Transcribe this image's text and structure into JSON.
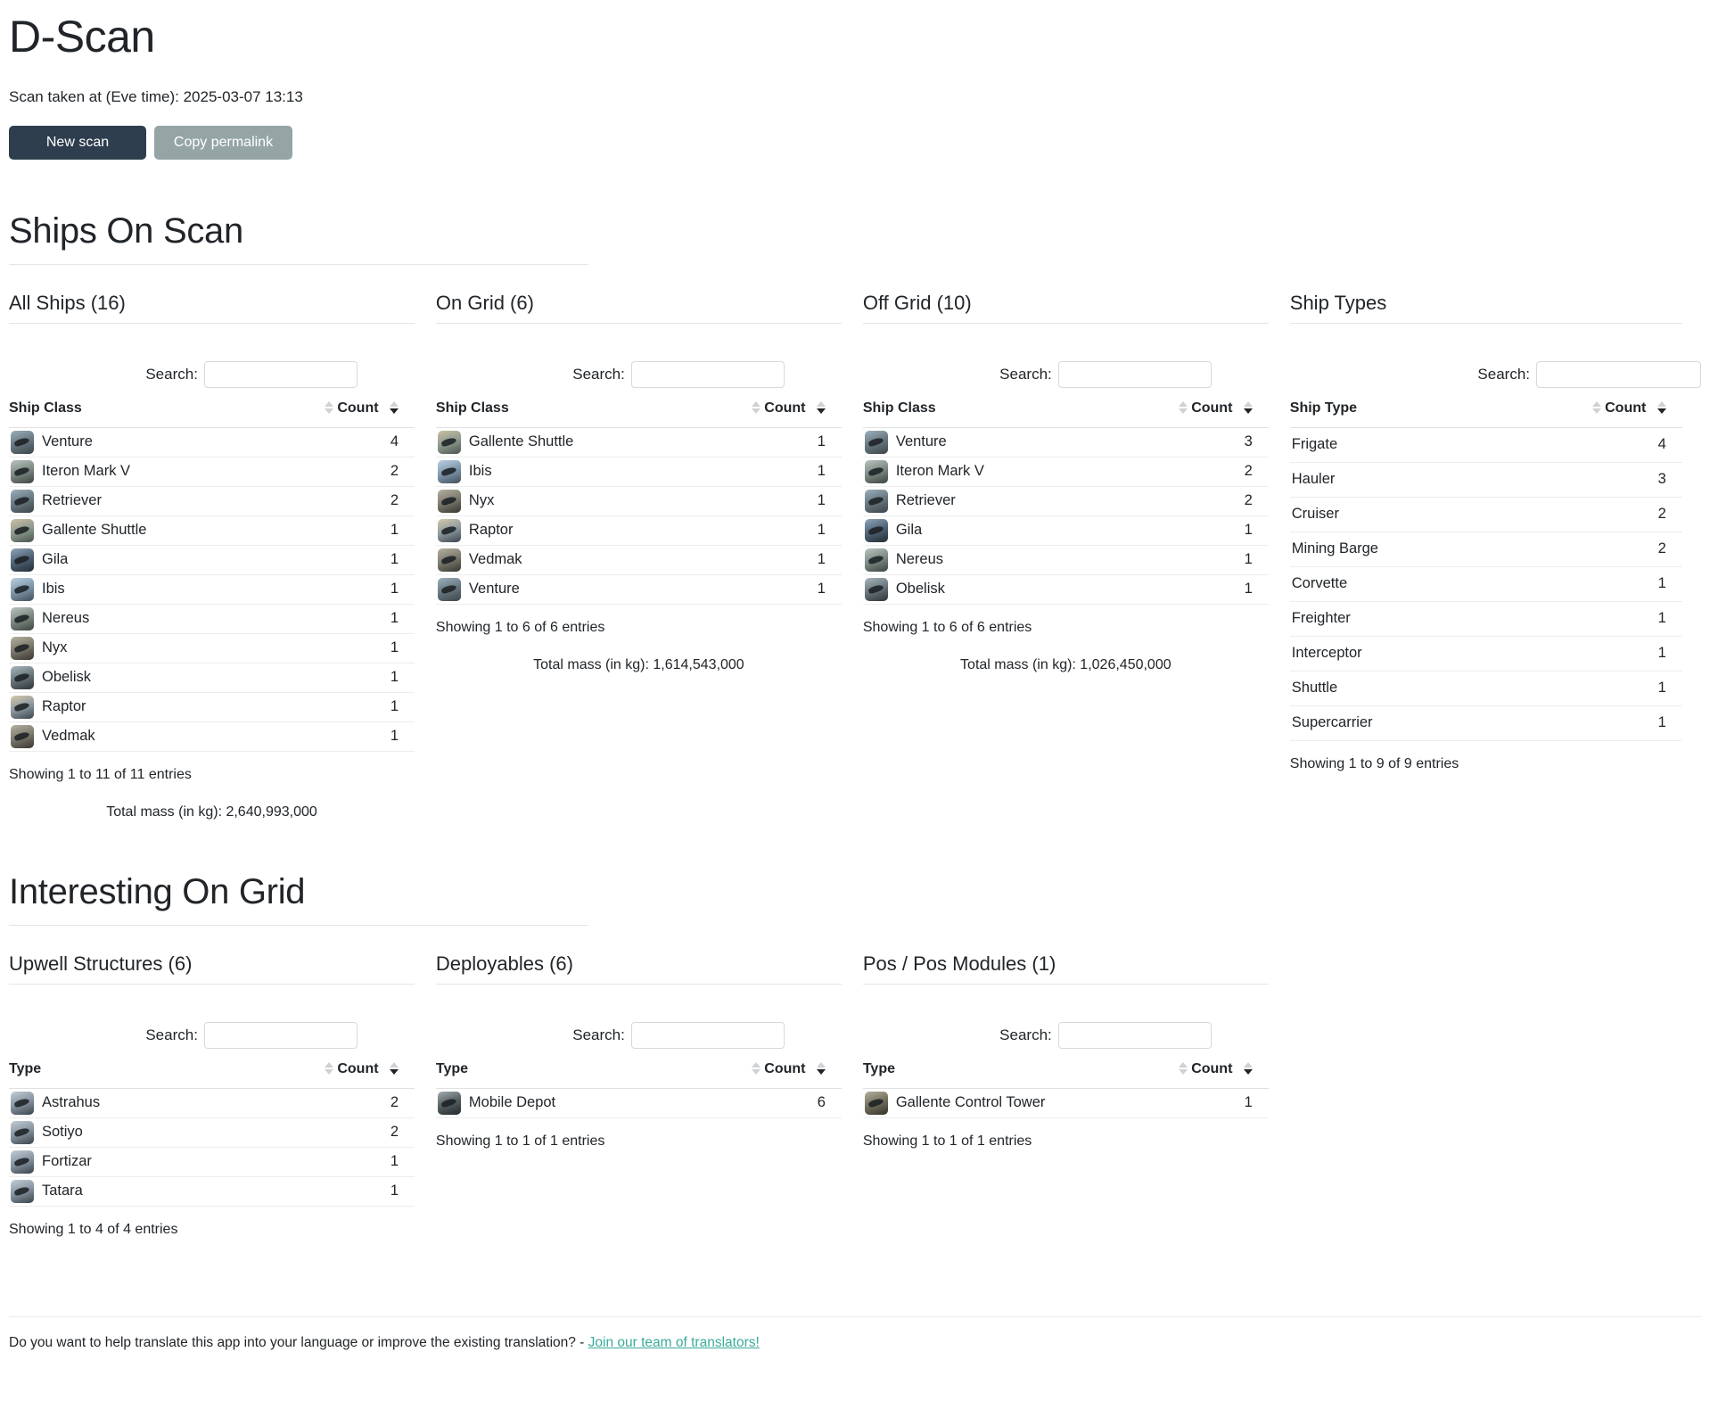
{
  "header": {
    "title": "D-Scan",
    "scan_time_label": "Scan taken at (Eve time): 2025-03-07 13:13",
    "new_scan_label": "New scan",
    "copy_permalink_label": "Copy permalink"
  },
  "sections": {
    "ships_on_scan": "Ships On Scan",
    "interesting_on_grid": "Interesting On Grid"
  },
  "common": {
    "search_label": "Search:",
    "search_placeholder": "",
    "search_value": ""
  },
  "all_ships": {
    "title": "All Ships (16)",
    "columns": {
      "name": "Ship Class",
      "count": "Count"
    },
    "rows": [
      {
        "name": "Venture",
        "count": "4",
        "icon": "t-venture"
      },
      {
        "name": "Iteron Mark V",
        "count": "2",
        "icon": "t-iteron"
      },
      {
        "name": "Retriever",
        "count": "2",
        "icon": "t-venture"
      },
      {
        "name": "Gallente Shuttle",
        "count": "1",
        "icon": "t-gallente"
      },
      {
        "name": "Gila",
        "count": "1",
        "icon": "t-gila"
      },
      {
        "name": "Ibis",
        "count": "1",
        "icon": "t-ibis"
      },
      {
        "name": "Nereus",
        "count": "1",
        "icon": "t-iteron"
      },
      {
        "name": "Nyx",
        "count": "1",
        "icon": "t-nyx"
      },
      {
        "name": "Obelisk",
        "count": "1",
        "icon": "t-obelisk"
      },
      {
        "name": "Raptor",
        "count": "1",
        "icon": "t-raptor"
      },
      {
        "name": "Vedmak",
        "count": "1",
        "icon": "t-nyx"
      }
    ],
    "showing": "Showing 1 to 11 of 11 entries",
    "total_mass": "Total mass (in kg): 2,640,993,000"
  },
  "on_grid": {
    "title": "On Grid (6)",
    "columns": {
      "name": "Ship Class",
      "count": "Count"
    },
    "rows": [
      {
        "name": "Gallente Shuttle",
        "count": "1",
        "icon": "t-gallente"
      },
      {
        "name": "Ibis",
        "count": "1",
        "icon": "t-ibis"
      },
      {
        "name": "Nyx",
        "count": "1",
        "icon": "t-nyx"
      },
      {
        "name": "Raptor",
        "count": "1",
        "icon": "t-raptor"
      },
      {
        "name": "Vedmak",
        "count": "1",
        "icon": "t-nyx"
      },
      {
        "name": "Venture",
        "count": "1",
        "icon": "t-venture"
      }
    ],
    "showing": "Showing 1 to 6 of 6 entries",
    "total_mass": "Total mass (in kg): 1,614,543,000"
  },
  "off_grid": {
    "title": "Off Grid (10)",
    "columns": {
      "name": "Ship Class",
      "count": "Count"
    },
    "rows": [
      {
        "name": "Venture",
        "count": "3",
        "icon": "t-venture"
      },
      {
        "name": "Iteron Mark V",
        "count": "2",
        "icon": "t-iteron"
      },
      {
        "name": "Retriever",
        "count": "2",
        "icon": "t-venture"
      },
      {
        "name": "Gila",
        "count": "1",
        "icon": "t-gila"
      },
      {
        "name": "Nereus",
        "count": "1",
        "icon": "t-iteron"
      },
      {
        "name": "Obelisk",
        "count": "1",
        "icon": "t-obelisk"
      }
    ],
    "showing": "Showing 1 to 6 of 6 entries",
    "total_mass": "Total mass (in kg): 1,026,450,000"
  },
  "ship_types": {
    "title": "Ship Types",
    "columns": {
      "name": "Ship Type",
      "count": "Count"
    },
    "rows": [
      {
        "name": "Frigate",
        "count": "4"
      },
      {
        "name": "Hauler",
        "count": "3"
      },
      {
        "name": "Cruiser",
        "count": "2"
      },
      {
        "name": "Mining Barge",
        "count": "2"
      },
      {
        "name": "Corvette",
        "count": "1"
      },
      {
        "name": "Freighter",
        "count": "1"
      },
      {
        "name": "Interceptor",
        "count": "1"
      },
      {
        "name": "Shuttle",
        "count": "1"
      },
      {
        "name": "Supercarrier",
        "count": "1"
      }
    ],
    "showing": "Showing 1 to 9 of 9 entries"
  },
  "upwell_structures": {
    "title": "Upwell Structures (6)",
    "columns": {
      "name": "Type",
      "count": "Count"
    },
    "rows": [
      {
        "name": "Astrahus",
        "count": "2",
        "icon": "t-struct"
      },
      {
        "name": "Sotiyo",
        "count": "2",
        "icon": "t-struct"
      },
      {
        "name": "Fortizar",
        "count": "1",
        "icon": "t-struct"
      },
      {
        "name": "Tatara",
        "count": "1",
        "icon": "t-struct"
      }
    ],
    "showing": "Showing 1 to 4 of 4 entries"
  },
  "deployables": {
    "title": "Deployables (6)",
    "columns": {
      "name": "Type",
      "count": "Count"
    },
    "rows": [
      {
        "name": "Mobile Depot",
        "count": "6",
        "icon": "t-depot"
      }
    ],
    "showing": "Showing 1 to 1 of 1 entries"
  },
  "pos_modules": {
    "title": "Pos / Pos Modules (1)",
    "columns": {
      "name": "Type",
      "count": "Count"
    },
    "rows": [
      {
        "name": "Gallente Control Tower",
        "count": "1",
        "icon": "t-tower"
      }
    ],
    "showing": "Showing 1 to 1 of 1 entries"
  },
  "footer": {
    "text": "Do you want to help translate this app into your language or improve the existing translation? -",
    "link": "Join our team of translators!"
  },
  "colors": {
    "primary_button": "#2f3e4e",
    "secondary_button": "#95a5a6",
    "link": "#3aab9a",
    "text": "#212529",
    "border": "#e3e5e7"
  }
}
